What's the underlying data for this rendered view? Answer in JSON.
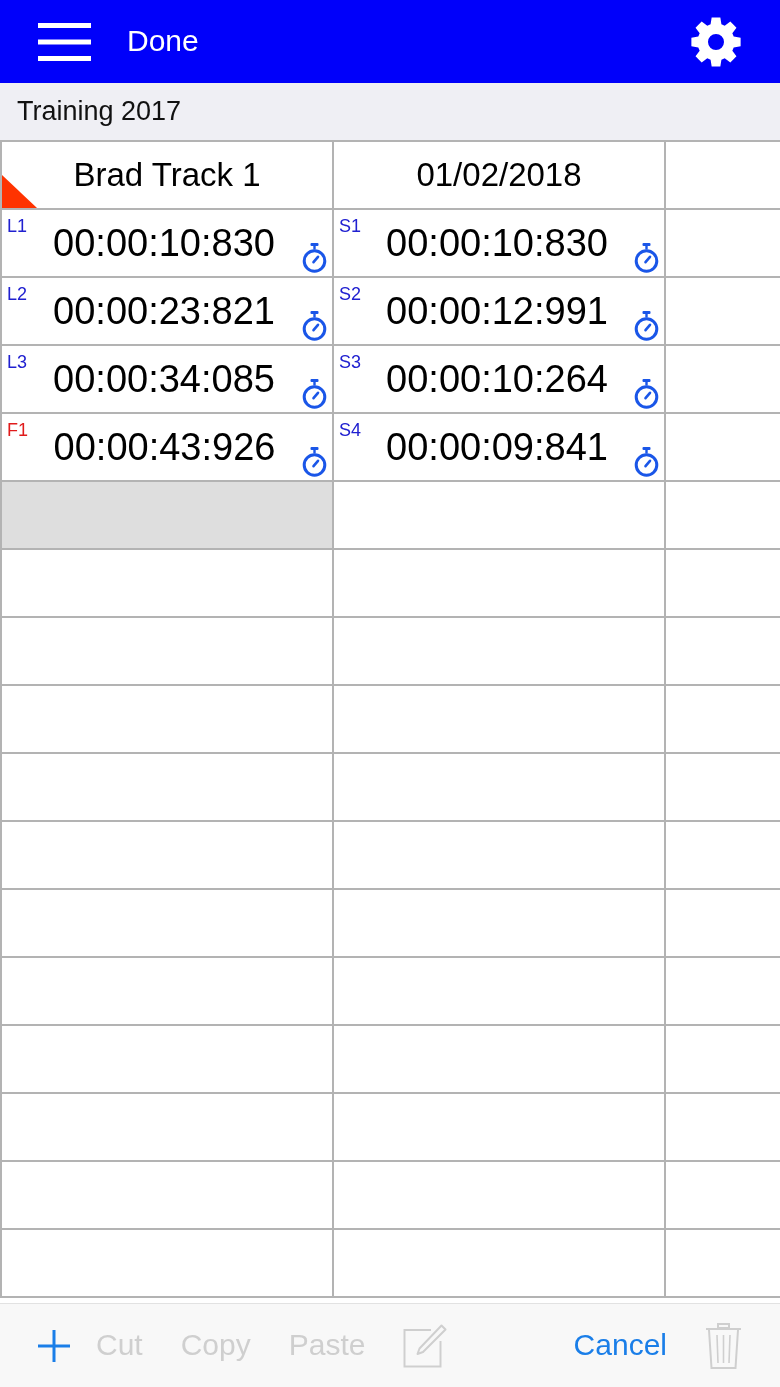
{
  "top_bar": {
    "title": "Done"
  },
  "sheet": {
    "title": "Training 2017"
  },
  "grid": {
    "rows": [
      {
        "cells": [
          {
            "kind": "header",
            "text": "Brad Track 1",
            "flagged": true,
            "selected": false
          },
          {
            "kind": "header",
            "text": "01/02/2018",
            "flagged": false,
            "selected": false
          },
          {
            "kind": "empty",
            "selected": false
          }
        ]
      },
      {
        "cells": [
          {
            "kind": "time",
            "tag": "L1",
            "color": "#2020d0",
            "time": "00:00:10:830",
            "selected": false
          },
          {
            "kind": "time",
            "tag": "S1",
            "color": "#2020d0",
            "time": "00:00:10:830",
            "selected": false
          },
          {
            "kind": "empty",
            "selected": false
          }
        ]
      },
      {
        "cells": [
          {
            "kind": "time",
            "tag": "L2",
            "color": "#2020d0",
            "time": "00:00:23:821",
            "selected": false
          },
          {
            "kind": "time",
            "tag": "S2",
            "color": "#2020d0",
            "time": "00:00:12:991",
            "selected": false
          },
          {
            "kind": "empty",
            "selected": false
          }
        ]
      },
      {
        "cells": [
          {
            "kind": "time",
            "tag": "L3",
            "color": "#2020d0",
            "time": "00:00:34:085",
            "selected": false
          },
          {
            "kind": "time",
            "tag": "S3",
            "color": "#2020d0",
            "time": "00:00:10:264",
            "selected": false
          },
          {
            "kind": "empty",
            "selected": false
          }
        ]
      },
      {
        "cells": [
          {
            "kind": "time",
            "tag": "F1",
            "color": "#e01b1b",
            "time": "00:00:43:926",
            "selected": false
          },
          {
            "kind": "time",
            "tag": "S4",
            "color": "#2020d0",
            "time": "00:00:09:841",
            "selected": false
          },
          {
            "kind": "empty",
            "selected": false
          }
        ]
      },
      {
        "cells": [
          {
            "kind": "empty",
            "selected": true
          },
          {
            "kind": "empty",
            "selected": false
          },
          {
            "kind": "empty",
            "selected": false
          }
        ]
      },
      {
        "cells": [
          {
            "kind": "empty",
            "selected": false
          },
          {
            "kind": "empty",
            "selected": false
          },
          {
            "kind": "empty",
            "selected": false
          }
        ]
      },
      {
        "cells": [
          {
            "kind": "empty",
            "selected": false
          },
          {
            "kind": "empty",
            "selected": false
          },
          {
            "kind": "empty",
            "selected": false
          }
        ]
      },
      {
        "cells": [
          {
            "kind": "empty",
            "selected": false
          },
          {
            "kind": "empty",
            "selected": false
          },
          {
            "kind": "empty",
            "selected": false
          }
        ]
      },
      {
        "cells": [
          {
            "kind": "empty",
            "selected": false
          },
          {
            "kind": "empty",
            "selected": false
          },
          {
            "kind": "empty",
            "selected": false
          }
        ]
      },
      {
        "cells": [
          {
            "kind": "empty",
            "selected": false
          },
          {
            "kind": "empty",
            "selected": false
          },
          {
            "kind": "empty",
            "selected": false
          }
        ]
      },
      {
        "cells": [
          {
            "kind": "empty",
            "selected": false
          },
          {
            "kind": "empty",
            "selected": false
          },
          {
            "kind": "empty",
            "selected": false
          }
        ]
      },
      {
        "cells": [
          {
            "kind": "empty",
            "selected": false
          },
          {
            "kind": "empty",
            "selected": false
          },
          {
            "kind": "empty",
            "selected": false
          }
        ]
      },
      {
        "cells": [
          {
            "kind": "empty",
            "selected": false
          },
          {
            "kind": "empty",
            "selected": false
          },
          {
            "kind": "empty",
            "selected": false
          }
        ]
      },
      {
        "cells": [
          {
            "kind": "empty",
            "selected": false
          },
          {
            "kind": "empty",
            "selected": false
          },
          {
            "kind": "empty",
            "selected": false
          }
        ]
      },
      {
        "cells": [
          {
            "kind": "empty",
            "selected": false
          },
          {
            "kind": "empty",
            "selected": false
          },
          {
            "kind": "empty",
            "selected": false
          }
        ]
      },
      {
        "cells": [
          {
            "kind": "empty",
            "selected": false
          },
          {
            "kind": "empty",
            "selected": false
          },
          {
            "kind": "empty",
            "selected": false
          }
        ]
      }
    ]
  },
  "toolbar": {
    "left": [
      {
        "kind": "add",
        "disabled": false
      },
      {
        "kind": "text",
        "label": "Cut",
        "disabled": true
      },
      {
        "kind": "text",
        "label": "Copy",
        "disabled": true
      },
      {
        "kind": "text",
        "label": "Paste",
        "disabled": true
      },
      {
        "kind": "edit",
        "disabled": true
      }
    ],
    "right": [
      {
        "kind": "text",
        "label": "Cancel",
        "disabled": false
      },
      {
        "kind": "delete",
        "disabled": true
      }
    ]
  }
}
